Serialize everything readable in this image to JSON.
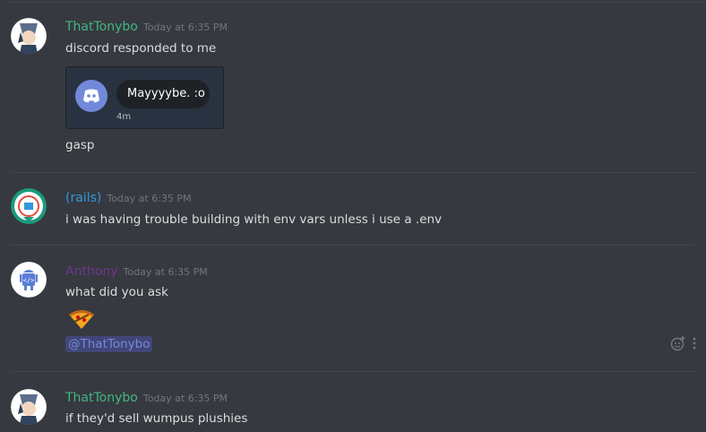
{
  "messages": [
    {
      "username": "ThatTonybo",
      "username_color": "#43b581",
      "timestamp": "Today at 6:35 PM",
      "lines": [
        "discord responded to me",
        "gasp"
      ],
      "embed": {
        "bubble_text": "Mayyyybe. :o",
        "ago": "4m"
      }
    },
    {
      "username": "(rails)",
      "username_color": "#3498db",
      "timestamp": "Today at 6:35 PM",
      "lines": [
        "i was having trouble building with env vars unless i use a .env"
      ]
    },
    {
      "username": "Anthony",
      "username_color": "#71368a",
      "timestamp": "Today at 6:35 PM",
      "lines": [
        "what did you ask"
      ],
      "mention": "@ThatTonybo"
    },
    {
      "username": "ThatTonybo",
      "username_color": "#43b581",
      "timestamp": "Today at 6:35 PM",
      "lines": [
        "if they'd sell wumpus plushies"
      ]
    }
  ],
  "icons": {
    "add_reaction": "add-reaction-icon",
    "more": "more-icon"
  }
}
